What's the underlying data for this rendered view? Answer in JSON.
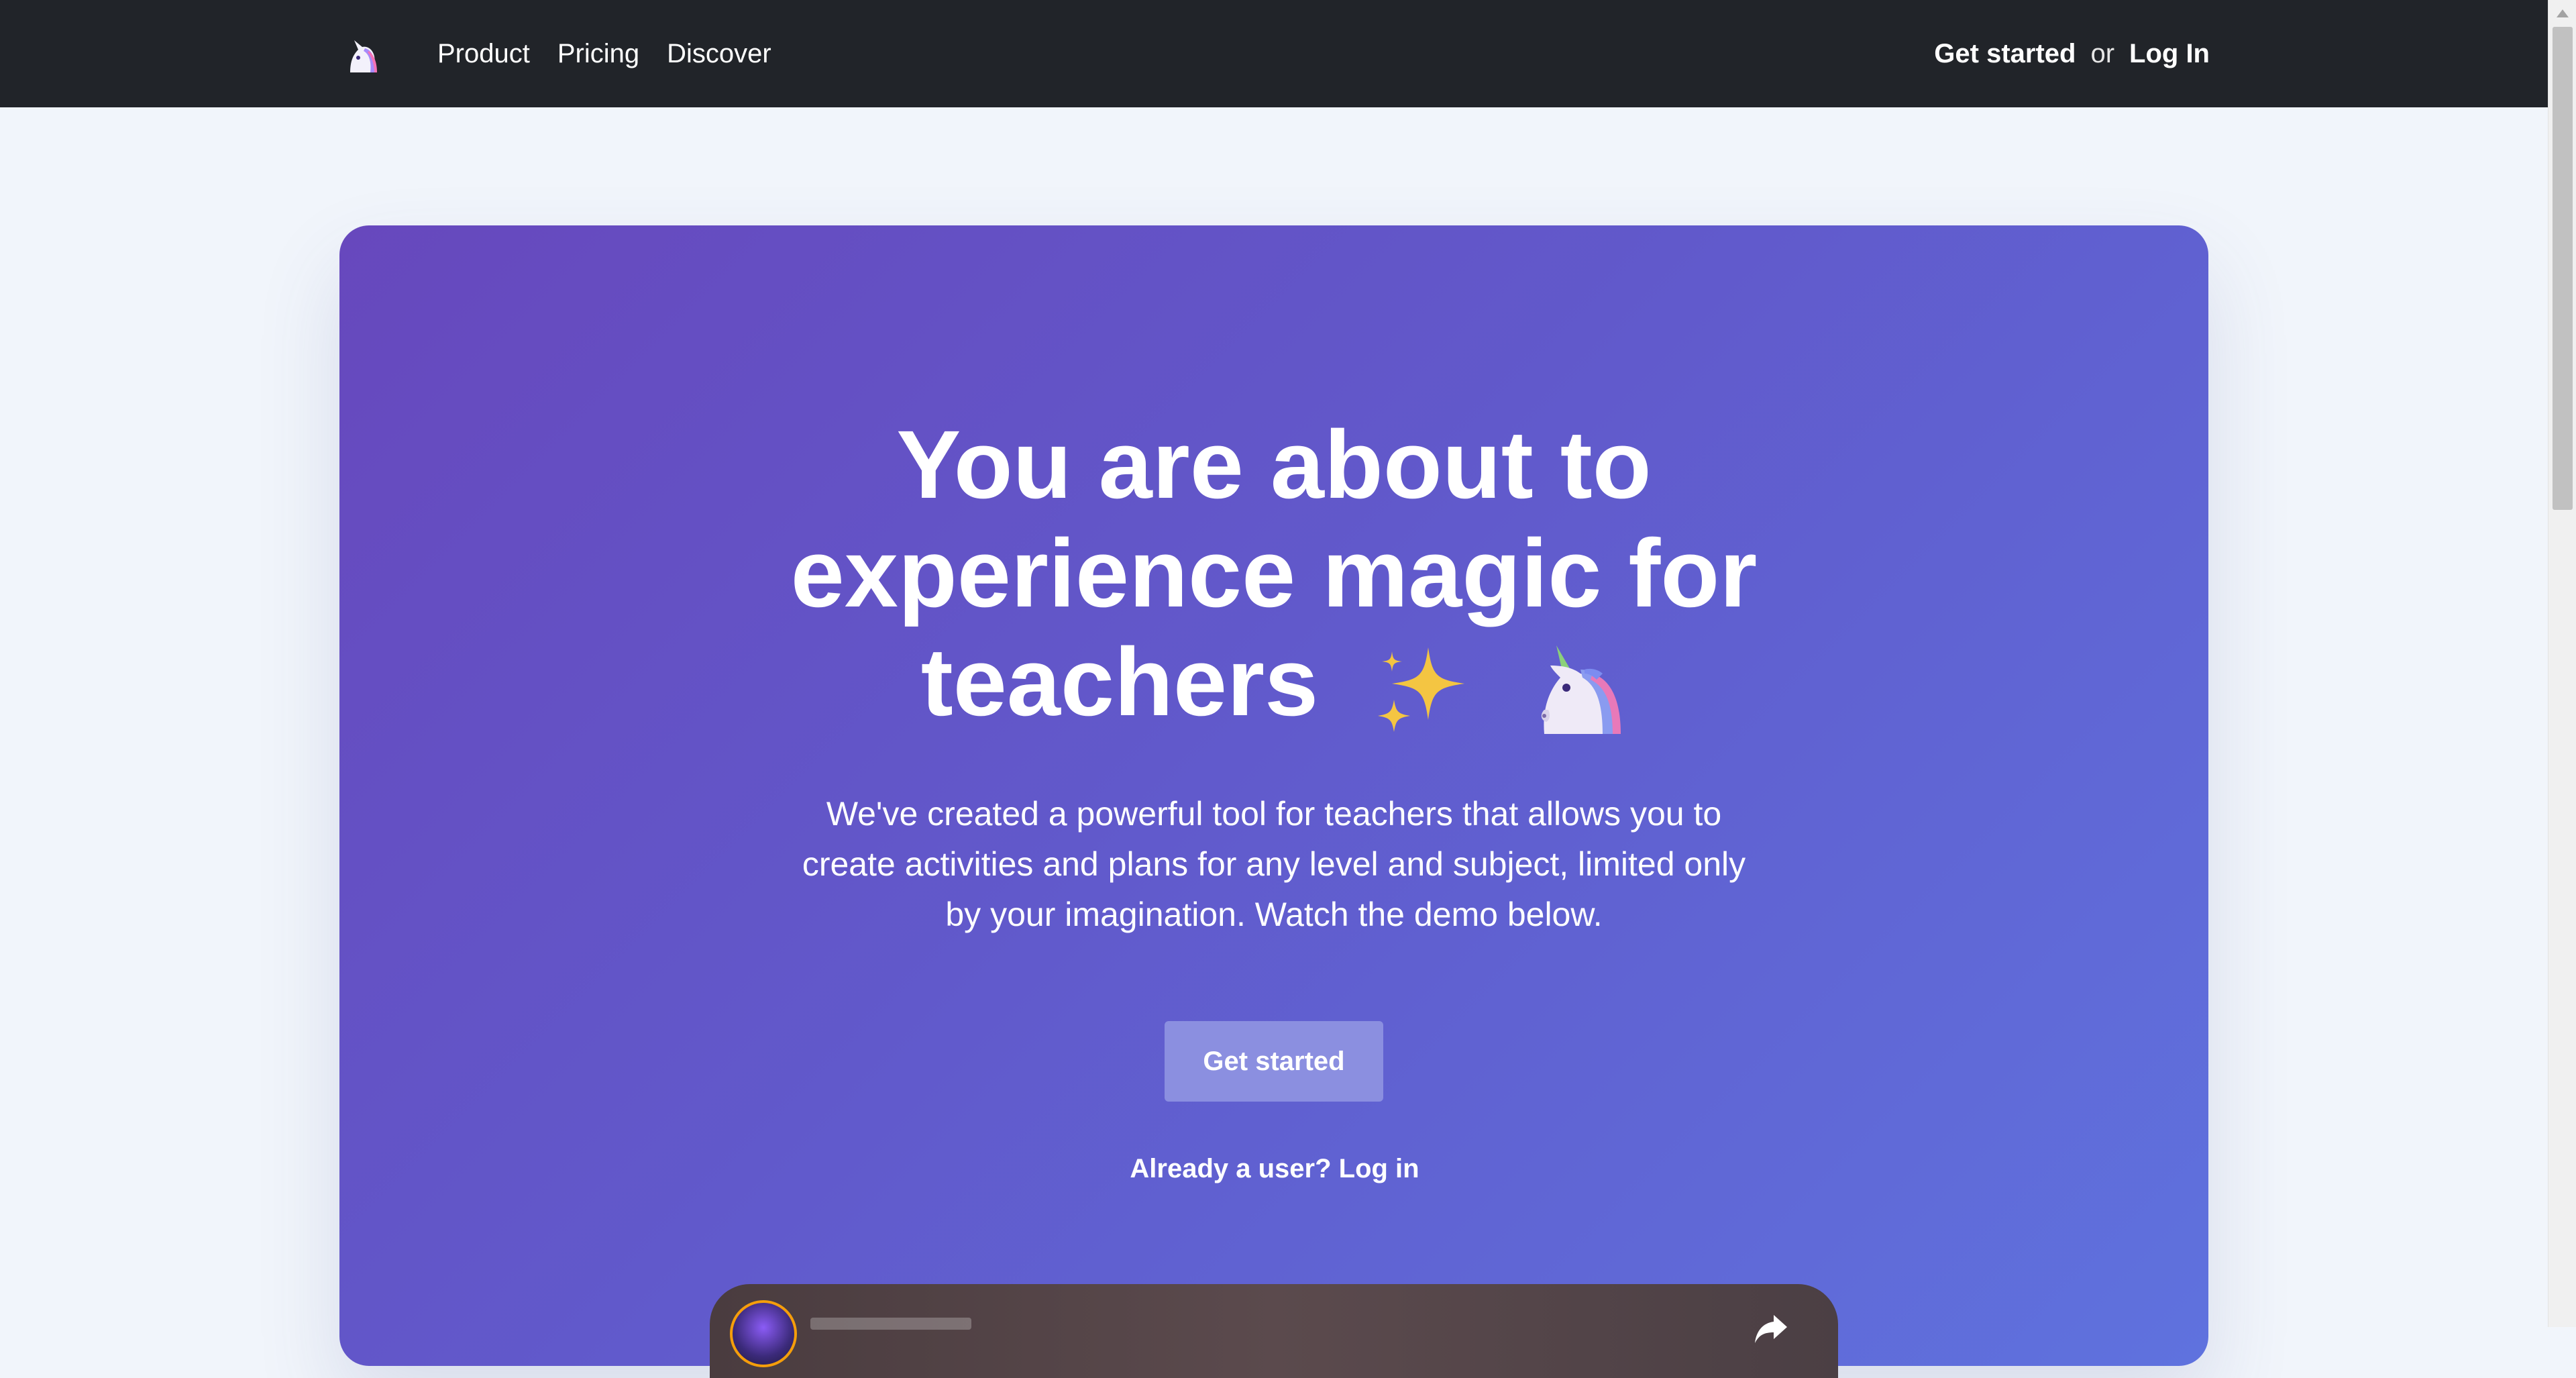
{
  "nav": {
    "logo_icon": "unicorn-icon",
    "links": [
      "Product",
      "Pricing",
      "Discover"
    ],
    "get_started": "Get started",
    "or_text": "or",
    "log_in": "Log In"
  },
  "hero": {
    "title_line1": "You are about to",
    "title_line2": "experience magic for",
    "title_line3": "teachers",
    "title_emojis": [
      "sparkles-icon",
      "unicorn-icon"
    ],
    "subtitle": "We've created a powerful tool for teachers that allows you to create activities and plans for any level and subject, limited only by your imagination. Watch the demo below.",
    "cta_label": "Get started",
    "login_prompt": "Already a user? Log in"
  },
  "colors": {
    "nav_bg": "#212429",
    "page_bg": "#f1f5fb",
    "hero_gradient_start": "#6748bd",
    "hero_gradient_end": "#5f72de",
    "cta_bg": "#8b8fe0"
  }
}
